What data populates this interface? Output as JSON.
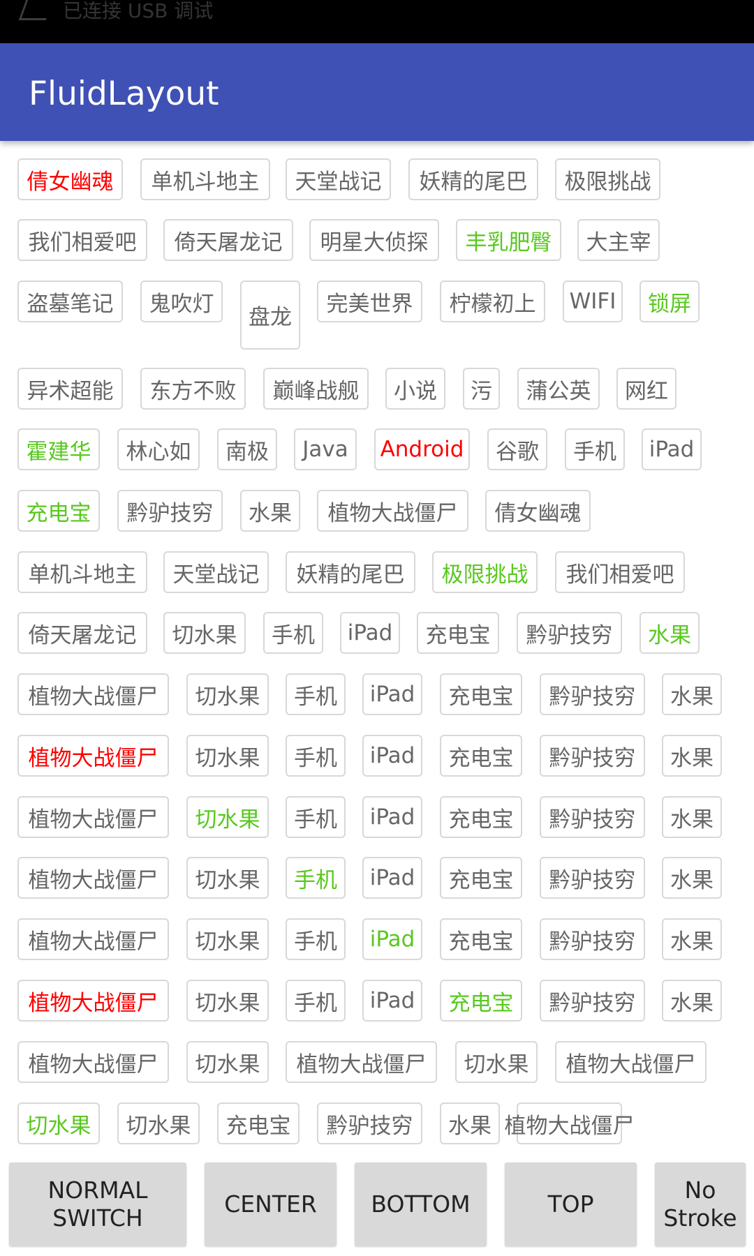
{
  "status_bar": {
    "text": "已连接 USB 调试"
  },
  "app_bar": {
    "title": "FluidLayout"
  },
  "colors": {
    "app_bar": "#3f51b5",
    "tag_default": "#666666",
    "tag_red": "#ff0000",
    "tag_green": "#59c81f",
    "tag_border": "#d8d8d8",
    "button_bg": "#d9d9d9"
  },
  "tag_rows": [
    [
      {
        "text": "倩女幽魂",
        "color": "red"
      },
      {
        "text": "单机斗地主"
      },
      {
        "text": "天堂战记"
      },
      {
        "text": "妖精的尾巴"
      },
      {
        "text": "极限挑战"
      }
    ],
    [
      {
        "text": "我们相爱吧"
      },
      {
        "text": "倚天屠龙记"
      },
      {
        "text": "明星大侦探"
      },
      {
        "text": "丰乳肥臀",
        "color": "green"
      },
      {
        "text": "大主宰"
      }
    ],
    [
      {
        "text": "盗墓笔记"
      },
      {
        "text": "鬼吹灯"
      },
      {
        "text": "盘龙",
        "tall": true
      },
      {
        "text": "完美世界"
      },
      {
        "text": "柠檬初上"
      },
      {
        "text": "WIFI"
      },
      {
        "text": "锁屏",
        "color": "green"
      }
    ],
    [
      {
        "text": "异术超能"
      },
      {
        "text": "东方不败"
      },
      {
        "text": "巅峰战舰"
      },
      {
        "text": "小说"
      },
      {
        "text": "污"
      },
      {
        "text": "蒲公英"
      },
      {
        "text": "网红"
      }
    ],
    [
      {
        "text": "霍建华",
        "color": "green"
      },
      {
        "text": "林心如"
      },
      {
        "text": "南极"
      },
      {
        "text": "Java"
      },
      {
        "text": "Android",
        "color": "red"
      },
      {
        "text": "谷歌"
      },
      {
        "text": "手机"
      },
      {
        "text": "iPad"
      }
    ],
    [
      {
        "text": "充电宝",
        "color": "green"
      },
      {
        "text": "黔驴技穷"
      },
      {
        "text": "水果"
      },
      {
        "text": "植物大战僵尸"
      },
      {
        "text": "倩女幽魂"
      }
    ],
    [
      {
        "text": "单机斗地主"
      },
      {
        "text": "天堂战记"
      },
      {
        "text": "妖精的尾巴"
      },
      {
        "text": "极限挑战",
        "color": "green"
      },
      {
        "text": "我们相爱吧"
      }
    ],
    [
      {
        "text": "倚天屠龙记"
      },
      {
        "text": "切水果"
      },
      {
        "text": "手机"
      },
      {
        "text": "iPad"
      },
      {
        "text": "充电宝"
      },
      {
        "text": "黔驴技穷"
      },
      {
        "text": "水果",
        "color": "green"
      }
    ],
    [
      {
        "text": "植物大战僵尸"
      },
      {
        "text": "切水果"
      },
      {
        "text": "手机"
      },
      {
        "text": "iPad"
      },
      {
        "text": "充电宝"
      },
      {
        "text": "黔驴技穷"
      },
      {
        "text": "水果"
      }
    ],
    [
      {
        "text": "植物大战僵尸",
        "color": "red"
      },
      {
        "text": "切水果"
      },
      {
        "text": "手机"
      },
      {
        "text": "iPad"
      },
      {
        "text": "充电宝"
      },
      {
        "text": "黔驴技穷"
      },
      {
        "text": "水果"
      }
    ],
    [
      {
        "text": "植物大战僵尸"
      },
      {
        "text": "切水果",
        "color": "green"
      },
      {
        "text": "手机"
      },
      {
        "text": "iPad"
      },
      {
        "text": "充电宝"
      },
      {
        "text": "黔驴技穷"
      },
      {
        "text": "水果"
      }
    ],
    [
      {
        "text": "植物大战僵尸"
      },
      {
        "text": "切水果"
      },
      {
        "text": "手机",
        "color": "green"
      },
      {
        "text": "iPad"
      },
      {
        "text": "充电宝"
      },
      {
        "text": "黔驴技穷"
      },
      {
        "text": "水果"
      }
    ],
    [
      {
        "text": "植物大战僵尸"
      },
      {
        "text": "切水果"
      },
      {
        "text": "手机"
      },
      {
        "text": "iPad",
        "color": "green"
      },
      {
        "text": "充电宝"
      },
      {
        "text": "黔驴技穷"
      },
      {
        "text": "水果"
      }
    ],
    [
      {
        "text": "植物大战僵尸",
        "color": "red"
      },
      {
        "text": "切水果"
      },
      {
        "text": "手机"
      },
      {
        "text": "iPad"
      },
      {
        "text": "充电宝",
        "color": "green"
      },
      {
        "text": "黔驴技穷"
      },
      {
        "text": "水果"
      }
    ],
    [
      {
        "text": "植物大战僵尸"
      },
      {
        "text": "切水果"
      },
      {
        "text": "植物大战僵尸"
      },
      {
        "text": "切水果"
      },
      {
        "text": "植物大战僵尸"
      }
    ],
    [
      {
        "text": "切水果",
        "color": "green"
      },
      {
        "text": "切水果"
      },
      {
        "text": "充电宝"
      },
      {
        "text": "黔驴技穷"
      },
      {
        "text": "水果"
      },
      {
        "text": "植物大战僵尸"
      }
    ]
  ],
  "buttons": [
    {
      "label": "NORMAL\nSWITCH"
    },
    {
      "label": "CENTER"
    },
    {
      "label": "BOTTOM"
    },
    {
      "label": "TOP"
    },
    {
      "label": "No\nStroke"
    }
  ]
}
